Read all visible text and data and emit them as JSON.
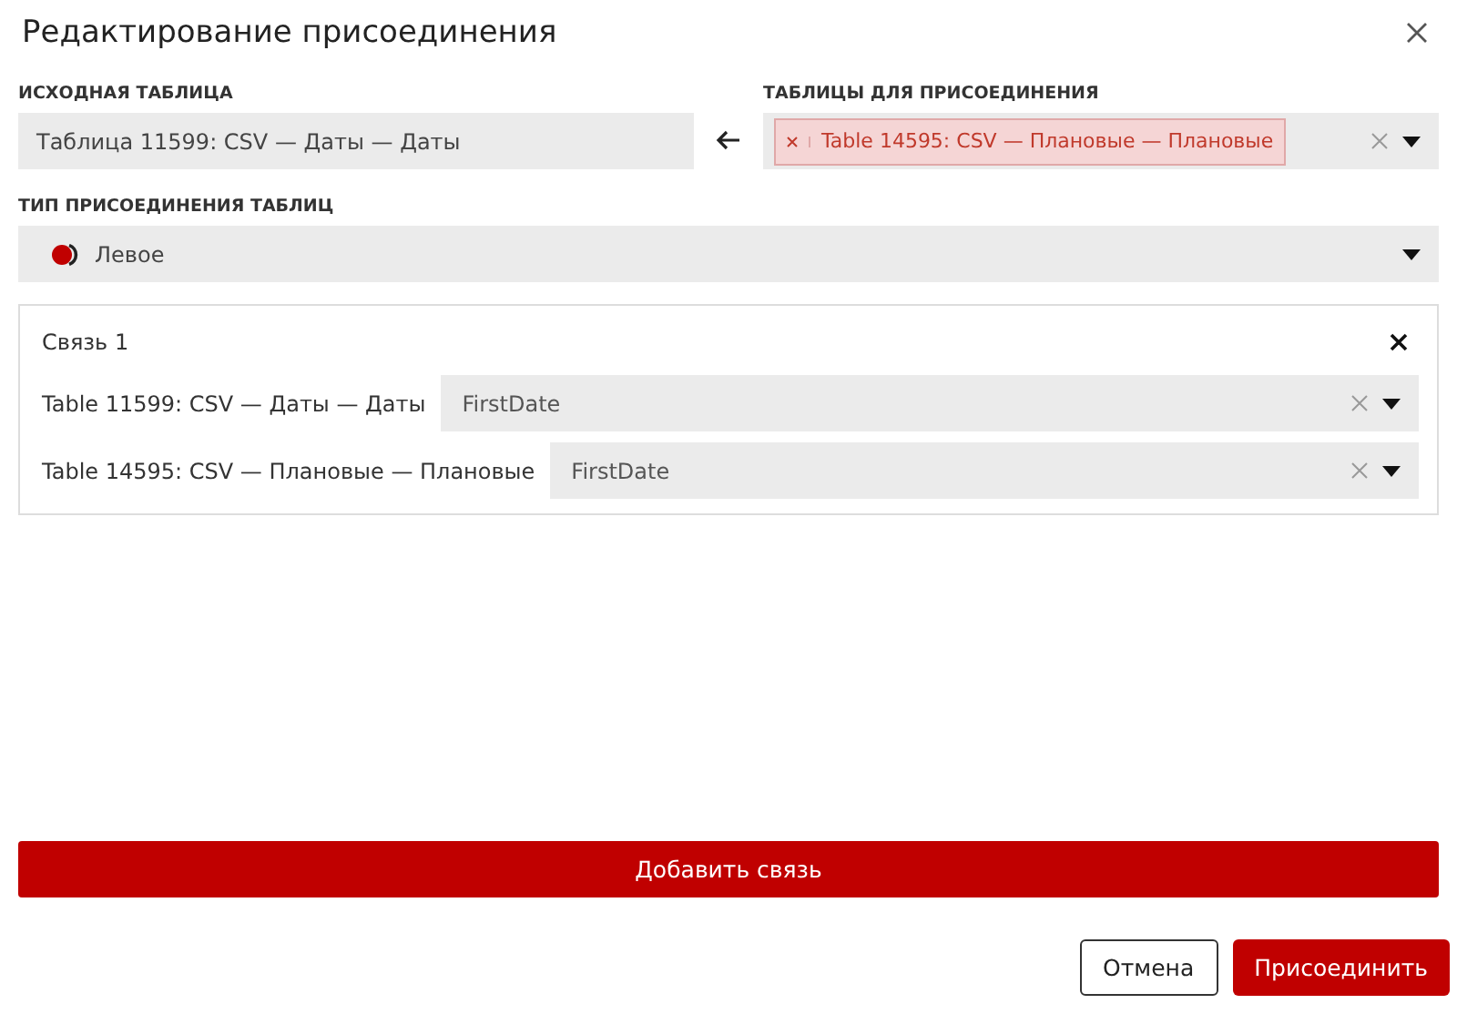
{
  "dialog": {
    "title": "Редактирование присоединения"
  },
  "source": {
    "label": "ИСХОДНАЯ ТАБЛИЦА",
    "value": "Таблица 11599: CSV — Даты — Даты"
  },
  "targets": {
    "label": "ТАБЛИЦЫ ДЛЯ ПРИСОЕДИНЕНИЯ",
    "tags": [
      "Table 14595: CSV — Плановые — Плановые"
    ]
  },
  "join_type": {
    "label": "ТИП ПРИСОЕДИНЕНИЯ ТАБЛИЦ",
    "value": "Левое"
  },
  "links": [
    {
      "title": "Связь 1",
      "rows": [
        {
          "table": "Table 11599: CSV — Даты — Даты",
          "field": "FirstDate"
        },
        {
          "table": "Table 14595: CSV — Плановые — Плановые",
          "field": "FirstDate"
        }
      ]
    }
  ],
  "add_button": "Добавить связь",
  "buttons": [
    {
      "label": "Отмена",
      "kind": "secondary"
    },
    {
      "label": "Присоединить",
      "kind": "primary"
    }
  ]
}
